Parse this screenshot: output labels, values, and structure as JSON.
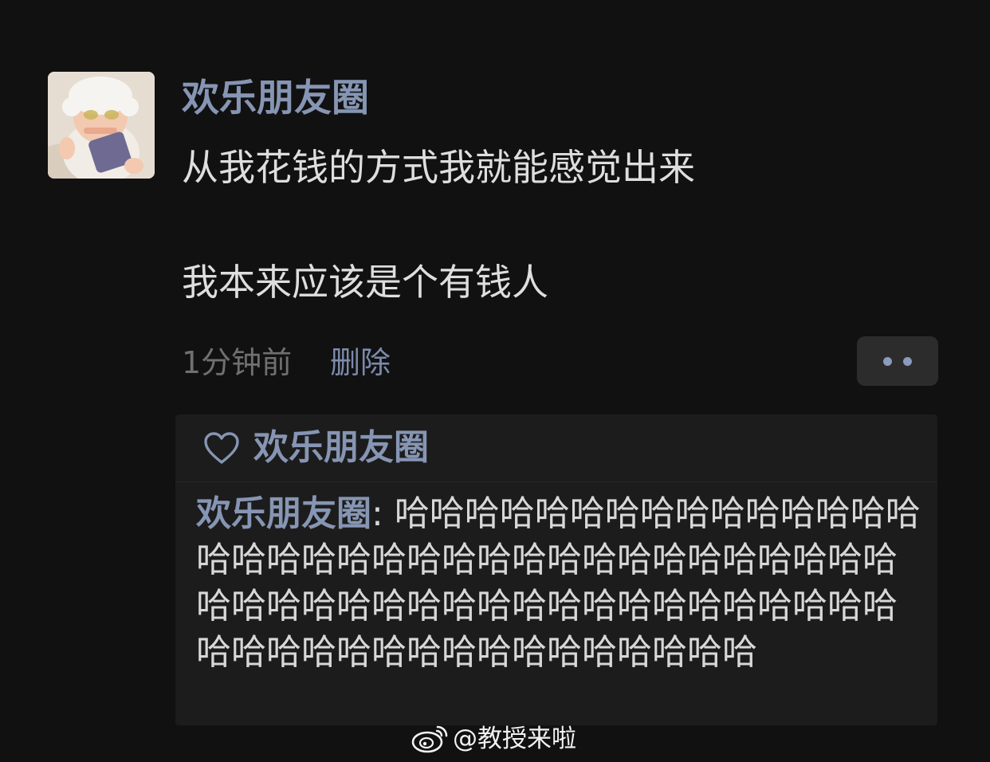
{
  "post": {
    "avatar": "baby-photo",
    "author_name": "欢乐朋友圈",
    "content_lines": [
      "从我花钱的方式我就能感觉出来",
      "我本来应该是个有钱人"
    ],
    "time": "1分钟前",
    "delete_label": "删除",
    "more_icon": "ellipsis-icon"
  },
  "interactions": {
    "like_icon": "heart-icon",
    "liked_by": "欢乐朋友圈",
    "comment": {
      "author": "欢乐朋友圈",
      "separator": ": ",
      "text": "哈哈哈哈哈哈哈哈哈哈哈哈哈哈哈哈哈哈哈哈哈哈哈哈哈哈哈哈哈哈哈哈哈哈哈哈哈哈哈哈哈哈哈哈哈哈哈哈哈哈哈哈哈哈哈哈哈哈哈哈哈哈哈哈哈哈哈哈哈哈哈"
    }
  },
  "watermark": {
    "icon": "weibo-icon",
    "text": "@教授来啦"
  },
  "colors": {
    "background": "#111111",
    "name_accent": "#8695b3",
    "body_text": "#dedede",
    "muted_text": "#707070",
    "panel": "#1c1c1c"
  }
}
